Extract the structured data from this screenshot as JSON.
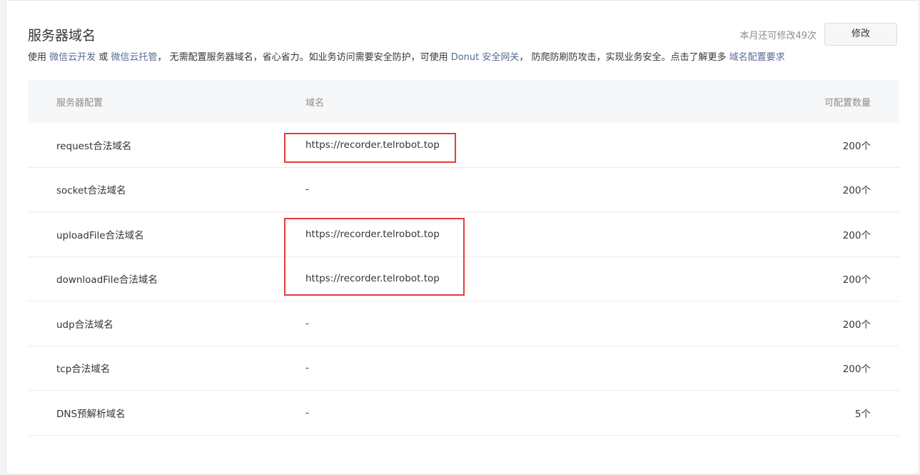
{
  "header": {
    "title": "服务器域名",
    "quota_text": "本月还可修改49次",
    "modify_label": "修改"
  },
  "description": {
    "part1": "使用 ",
    "link1": "微信云开发",
    "part2": " 或 ",
    "link2": "微信云托管",
    "part3": "， 无需配置服务器域名，省心省力。如业务访问需要安全防护，可使用 ",
    "link3": "Donut 安全网关",
    "part4": "， 防爬防刷防攻击，实现业务安全。点击了解更多 ",
    "link4": "域名配置要求"
  },
  "table": {
    "headers": [
      "服务器配置",
      "域名",
      "可配置数量"
    ],
    "rows": [
      {
        "config": "request合法域名",
        "domain": "https://recorder.telrobot.top",
        "count": "200个"
      },
      {
        "config": "socket合法域名",
        "domain": "-",
        "count": "200个"
      },
      {
        "config": "uploadFile合法域名",
        "domain": "https://recorder.telrobot.top",
        "count": "200个"
      },
      {
        "config": "downloadFile合法域名",
        "domain": "https://recorder.telrobot.top",
        "count": "200个"
      },
      {
        "config": "udp合法域名",
        "domain": "-",
        "count": "200个"
      },
      {
        "config": "tcp合法域名",
        "domain": "-",
        "count": "200个"
      },
      {
        "config": "DNS预解析域名",
        "domain": "-",
        "count": "5个"
      }
    ]
  },
  "colors": {
    "link": "#576b95",
    "highlight_box": "#e43c3c"
  }
}
